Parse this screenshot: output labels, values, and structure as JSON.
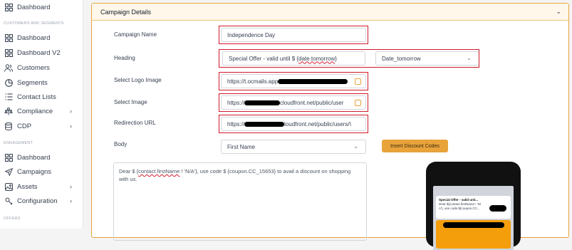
{
  "sidebar": {
    "top_item": "Dashboard",
    "section_customers": "CUSTOMERS AND SEGMENTS",
    "customers_items": [
      "Dashboard",
      "Dashboard V2",
      "Customers",
      "Segments",
      "Contact Lists",
      "Compliance",
      "CDP"
    ],
    "section_engagement": "ENGAGEMENT",
    "engagement_items": [
      "Dashboard",
      "Campaigns",
      "Assets",
      "Configuration"
    ],
    "section_offers": "OFFERS"
  },
  "card": {
    "title": "Campaign Details"
  },
  "form": {
    "campaign_name_label": "Campaign Name",
    "campaign_name_value": "Independence Day",
    "heading_label": "Heading",
    "heading_value_prefix": "Special Offer - valid until $ {",
    "heading_value_var": "date.tomorrow",
    "heading_value_suffix": "}",
    "heading_select": "Date_tomorrow",
    "logo_label": "Select Logo Image",
    "logo_value_prefix": "https://t.ocmails.app",
    "image_label": "Select Image",
    "image_value_prefix": "https://",
    "image_value_suffix": "cloudfront.net/public/user",
    "redirect_label": "Redirection URL",
    "redirect_value_prefix": "https://",
    "redirect_value_suffix": "loudfront.net/public/users/\\",
    "body_label": "Body",
    "body_select": "First Name",
    "insert_discount_button": "Insert Discount Codes",
    "body_text_1": "Dear $ {",
    "body_text_var": "contact.firstName",
    "body_text_2": " ! 'N/A'}, use code $ {coupon.CC_15653} to avail a discount on shopping with us."
  },
  "preview": {
    "title": "Special Offer - valid unti...",
    "line1": "Dear ${contact.firstName ! 'N/",
    "line2": "A'}, use code ${coupon.CC..."
  },
  "colors": {
    "accent": "#e8a33b",
    "highlight": "#d11a2a"
  }
}
